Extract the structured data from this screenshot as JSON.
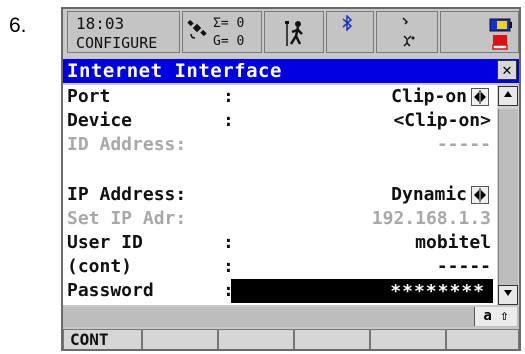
{
  "step": {
    "number": "6."
  },
  "status": {
    "time": "18:03",
    "mode": "CONFIGURE",
    "sigma": "Σ= 0",
    "g": "G= 0"
  },
  "dialog": {
    "title": "Internet Interface",
    "close_label": "✕"
  },
  "fields": [
    {
      "label": "Port",
      "colon": ":",
      "value": "Clip-on",
      "enabled": true,
      "selectable": true
    },
    {
      "label": "Device",
      "colon": ":",
      "value": "<Clip-on>",
      "enabled": true
    },
    {
      "label": "ID Address:",
      "colon": "",
      "value": "-----",
      "enabled": false
    },
    {
      "label": "IP Address:",
      "colon": "",
      "value": "Dynamic",
      "enabled": true,
      "selectable": true
    },
    {
      "label": "Set IP Adr:",
      "colon": "",
      "value": "192.168.1.3",
      "enabled": false
    },
    {
      "label": "User ID",
      "colon": ":",
      "value": "mobitel",
      "enabled": true
    },
    {
      "label": "(cont)",
      "colon": ":",
      "value": "-----",
      "enabled": true
    },
    {
      "label": "Password",
      "colon": ":",
      "value": "********",
      "enabled": true,
      "highlighted": true
    }
  ],
  "input_mode": "a ⇧",
  "softkeys": [
    "CONT",
    "",
    "",
    "",
    "",
    ""
  ],
  "colors": {
    "title_bar": "#0000e0",
    "screen_bg": "#c8c8c8",
    "content_bg": "#ffffff",
    "disabled_text": "#a8a8a8"
  },
  "icons": [
    "satellite-icon",
    "surveyor-icon",
    "bluetooth-icon",
    "radio-icon",
    "battery-icon",
    "memory-card-icon"
  ]
}
